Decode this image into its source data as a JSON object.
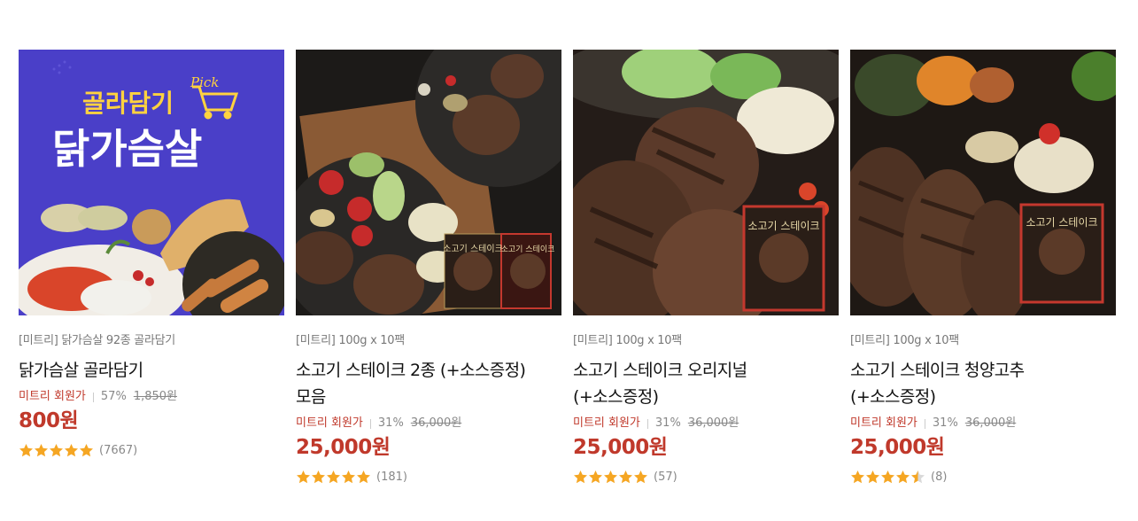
{
  "products": [
    {
      "brand": "[미트리]",
      "option": "닭가슴살 92종 골라담기",
      "title": "닭가슴살 골라담기",
      "member_label": "미트리 회원가",
      "discount": "57%",
      "original_price": "1,850원",
      "price": "800원",
      "rating": 5,
      "review_count": "(7667)",
      "banner_top": "골라담기",
      "banner_pick": "Pick",
      "banner_main": "닭가슴살",
      "image": "chicken-breast-banner"
    },
    {
      "brand": "[미트리]",
      "option": "100g x 10팩",
      "title": "소고기 스테이크 2종 (+소스증정) 모음",
      "member_label": "미트리 회원가",
      "discount": "31%",
      "original_price": "36,000원",
      "price": "25,000원",
      "rating": 5,
      "review_count": "(181)",
      "image": "beef-steak-two-types"
    },
    {
      "brand": "[미트리]",
      "option": "100g x 10팩",
      "title": "소고기 스테이크 오리지널 (+소스증정)",
      "member_label": "미트리 회원가",
      "discount": "31%",
      "original_price": "36,000원",
      "price": "25,000원",
      "rating": 5,
      "review_count": "(57)",
      "image": "beef-steak-original"
    },
    {
      "brand": "[미트리]",
      "option": "100g x 10팩",
      "title": "소고기 스테이크 청양고추 (+소스증정)",
      "member_label": "미트리 회원가",
      "discount": "31%",
      "original_price": "36,000원",
      "price": "25,000원",
      "rating": 4.5,
      "review_count": "(8)",
      "image": "beef-steak-cheongyang"
    }
  ],
  "package_label": "소고기 스테이크",
  "colors": {
    "accent": "#c0392b",
    "star": "#f5a623",
    "banner_bg": "#4a3fc8",
    "banner_yellow": "#ffd23f"
  }
}
